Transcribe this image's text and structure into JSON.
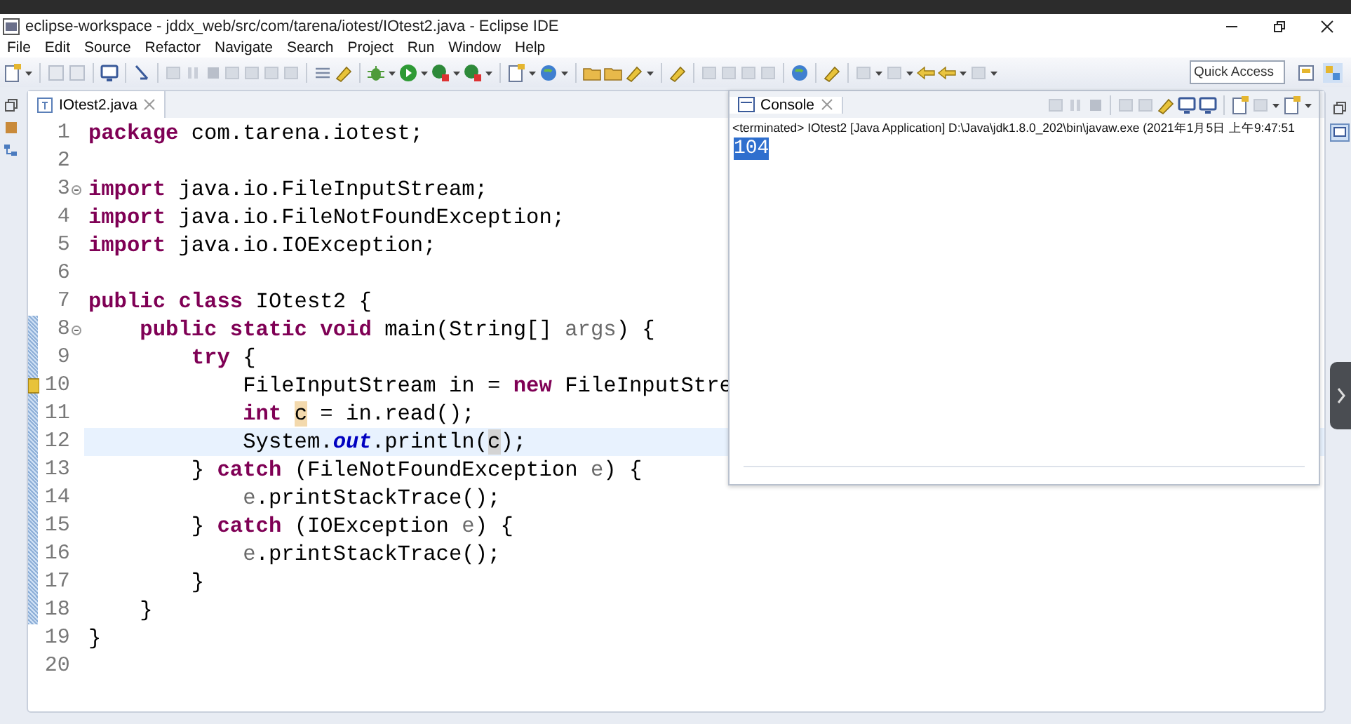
{
  "window": {
    "title": "eclipse-workspace - jddx_web/src/com/tarena/iotest/IOtest2.java - Eclipse IDE"
  },
  "menu": [
    "File",
    "Edit",
    "Source",
    "Refactor",
    "Navigate",
    "Search",
    "Project",
    "Run",
    "Window",
    "Help"
  ],
  "quick_access": {
    "placeholder": "Quick Access"
  },
  "editor": {
    "tab": {
      "label": "IOtest2.java",
      "selected": true
    },
    "lines": [
      {
        "number": "1",
        "current": false,
        "changed": false,
        "warning": false,
        "foldable": false,
        "segments": [
          {
            "kind": "keyword",
            "text": "package"
          },
          {
            "kind": "plain",
            "text": " com.tarena.iotest;"
          }
        ]
      },
      {
        "number": "2",
        "current": false,
        "changed": false,
        "warning": false,
        "foldable": false
      },
      {
        "number": "3",
        "current": false,
        "changed": false,
        "warning": false,
        "foldable": true,
        "segments": [
          {
            "kind": "keyword",
            "text": "import"
          },
          {
            "kind": "plain",
            "text": " java.io.FileInputStream;"
          }
        ]
      },
      {
        "number": "4",
        "current": false,
        "changed": false,
        "warning": false,
        "foldable": false,
        "segments": [
          {
            "kind": "keyword",
            "text": "import"
          },
          {
            "kind": "plain",
            "text": " java.io.FileNotFoundException;"
          }
        ]
      },
      {
        "number": "5",
        "current": false,
        "changed": false,
        "warning": false,
        "foldable": false,
        "segments": [
          {
            "kind": "keyword",
            "text": "import"
          },
          {
            "kind": "plain",
            "text": " java.io.IOException;"
          }
        ]
      },
      {
        "number": "6",
        "current": false,
        "changed": false,
        "warning": false,
        "foldable": false
      },
      {
        "number": "7",
        "current": false,
        "changed": false,
        "warning": false,
        "foldable": false,
        "segments": [
          {
            "kind": "keyword",
            "text": "public class"
          },
          {
            "kind": "plain",
            "text": " IOtest2 {"
          }
        ]
      },
      {
        "number": "8",
        "current": false,
        "changed": true,
        "warning": false,
        "foldable": true,
        "segments": [
          {
            "kind": "keyword",
            "text": "    public static void"
          },
          {
            "kind": "plain",
            "text": " main(String[] "
          },
          {
            "kind": "parameter",
            "text": "args"
          },
          {
            "kind": "plain",
            "text": ") {"
          }
        ]
      },
      {
        "number": "9",
        "current": false,
        "changed": true,
        "warning": false,
        "foldable": false,
        "segments": [
          {
            "kind": "keyword",
            "text": "        try"
          },
          {
            "kind": "plain",
            "text": " {"
          }
        ]
      },
      {
        "number": "10",
        "current": false,
        "changed": true,
        "warning": true,
        "foldable": false,
        "segments": [
          {
            "kind": "plain",
            "text": "            FileInputStream in = "
          },
          {
            "kind": "keyword",
            "text": "new"
          },
          {
            "kind": "plain",
            "text": " FileInputStre"
          }
        ]
      },
      {
        "number": "11",
        "current": false,
        "changed": true,
        "warning": false,
        "foldable": false,
        "segments": [
          {
            "kind": "keyword",
            "text": "            int "
          },
          {
            "kind": "write-occurrence",
            "text": "c"
          },
          {
            "kind": "plain",
            "text": " = in.read();"
          }
        ]
      },
      {
        "number": "12",
        "current": true,
        "changed": true,
        "warning": false,
        "foldable": false,
        "segments": [
          {
            "kind": "plain",
            "text": "            System."
          },
          {
            "kind": "field",
            "text": "out"
          },
          {
            "kind": "plain",
            "text": ".println("
          },
          {
            "kind": "read-occurrence",
            "text": "c"
          },
          {
            "kind": "plain",
            "text": ");"
          }
        ]
      },
      {
        "number": "13",
        "current": false,
        "changed": true,
        "warning": false,
        "foldable": false,
        "segments": [
          {
            "kind": "plain",
            "text": "        } "
          },
          {
            "kind": "keyword",
            "text": "catch"
          },
          {
            "kind": "plain",
            "text": " (FileNotFoundException "
          },
          {
            "kind": "parameter",
            "text": "e"
          },
          {
            "kind": "plain",
            "text": ") {"
          }
        ]
      },
      {
        "number": "14",
        "current": false,
        "changed": true,
        "warning": false,
        "foldable": false,
        "segments": [
          {
            "kind": "parameter",
            "text": "            e"
          },
          {
            "kind": "plain",
            "text": ".printStackTrace();"
          }
        ]
      },
      {
        "number": "15",
        "current": false,
        "changed": true,
        "warning": false,
        "foldable": false,
        "segments": [
          {
            "kind": "plain",
            "text": "        } "
          },
          {
            "kind": "keyword",
            "text": "catch"
          },
          {
            "kind": "plain",
            "text": " (IOException "
          },
          {
            "kind": "parameter",
            "text": "e"
          },
          {
            "kind": "plain",
            "text": ") {"
          }
        ]
      },
      {
        "number": "16",
        "current": false,
        "changed": true,
        "warning": false,
        "foldable": false,
        "segments": [
          {
            "kind": "parameter",
            "text": "            e"
          },
          {
            "kind": "plain",
            "text": ".printStackTrace();"
          }
        ]
      },
      {
        "number": "17",
        "current": false,
        "changed": true,
        "warning": false,
        "foldable": false,
        "segments": [
          {
            "kind": "plain",
            "text": "        }"
          }
        ]
      },
      {
        "number": "18",
        "current": false,
        "changed": true,
        "warning": false,
        "foldable": false,
        "segments": [
          {
            "kind": "plain",
            "text": "    }"
          }
        ]
      },
      {
        "number": "19",
        "current": false,
        "changed": false,
        "warning": false,
        "foldable": false,
        "segments": [
          {
            "kind": "plain",
            "text": "}"
          }
        ]
      },
      {
        "number": "20",
        "current": false,
        "changed": false,
        "warning": false,
        "foldable": false
      }
    ]
  },
  "console": {
    "tab": {
      "label": "Console",
      "selected": true
    },
    "header": "<terminated> IOtest2 [Java Application] D:\\Java\\jdk1.8.0_202\\bin\\javaw.exe (2021年1月5日 上午9:47:51",
    "output": [
      {
        "text": "104",
        "selected": true
      }
    ]
  }
}
